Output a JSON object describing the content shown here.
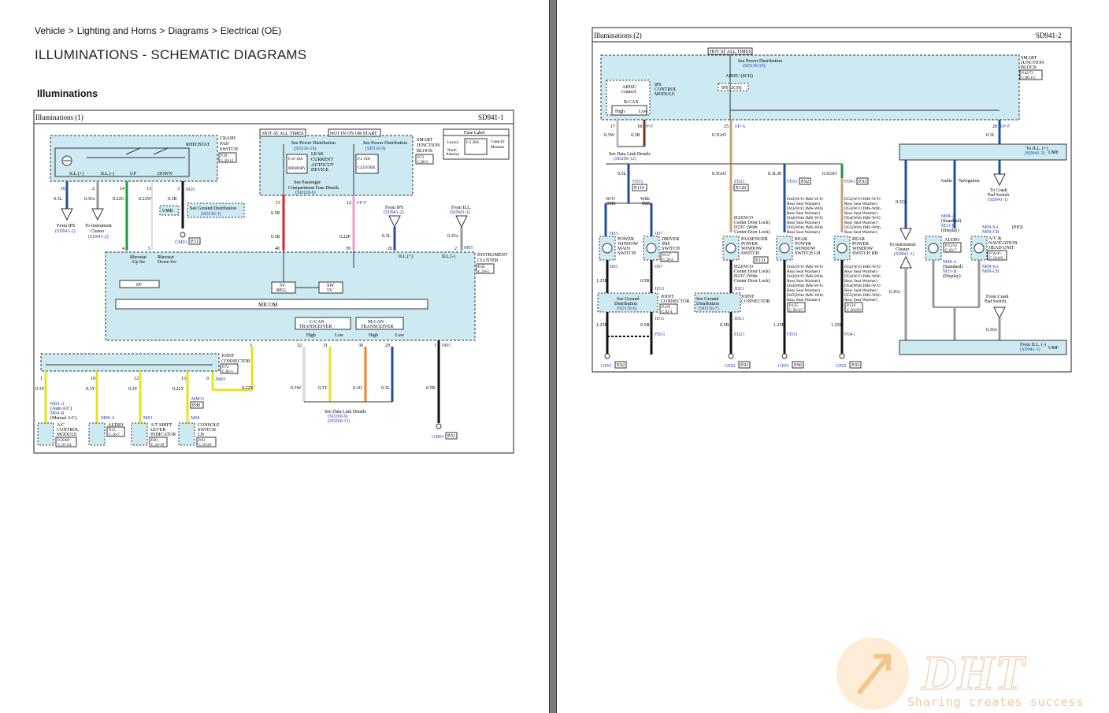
{
  "breadcrumb": [
    "Vehicle",
    "Lighting and Horns",
    "Diagrams",
    "Electrical (OE)"
  ],
  "page_title": "ILLUMINATIONS - SCHEMATIC DIAGRAMS",
  "section_title": "Illuminations",
  "diagram1": {
    "title": "Illuminations (1)",
    "code": "SD941-1",
    "crash_pad_switch": [
      "CRASH",
      "PAD",
      "SWITCH"
    ],
    "crash_pad_ref": [
      "P.39",
      "C.10-12"
    ],
    "rheostat": "RHEOSTAT",
    "ill_plus": "ILL.(+)",
    "ill_minus": "ILL.(-)",
    "up": "UP",
    "down": "DOWN",
    "hot_at_all_times": "HOT AT ALL TIMES",
    "hot_in_on_or_start": "HOT IN ON OR START",
    "see_power_distribution": "See Power Distribution",
    "sd110_10": "(SD110-10)",
    "sd110_9": "(SD110-9)",
    "leak_current": [
      "LEAK",
      "CURRENT",
      "AUTOCUT",
      "DEVICE"
    ],
    "f_memory": "F.10 10A",
    "memory": "MEMORY",
    "f_cluster": "F.2 10A",
    "cluster": "CLUSTER",
    "smart_junction_block": [
      "SMART",
      "JUNCTION",
      "BLOCK"
    ],
    "sjb_ref": [
      "P.72",
      "C.80-5"
    ],
    "see_passenger_fuse": [
      "See Passenger",
      "Compartment Fuse Details",
      "(SD120-9)"
    ],
    "fuse_label": "Fuse Label",
    "fuse_label_rows": [
      "Layout",
      "F.2 20A",
      "Capacity",
      "North",
      "America",
      "Measure"
    ],
    "pins_top": [
      "16",
      "2",
      "14",
      "13",
      "3"
    ],
    "wires_top": [
      "0.3L",
      "0.3Gr",
      "0.22G",
      "0.22W",
      "0.3B"
    ],
    "m26": "M26",
    "umb": "UMB",
    "see_ground_dist": [
      "See Ground Distribution",
      "(SD130-1)"
    ],
    "from_ips": [
      "From IPS",
      "(SD941-2)"
    ],
    "to_instrument_cluster": [
      "To Instrument",
      "Cluster",
      "(SD941-2)"
    ],
    "gm01": "GM01",
    "p51": "P.51",
    "sjb_pin_15": "15",
    "sjb_pin_12": "12",
    "i_p_f": "I/P-F",
    "wire_05r": "0.5R",
    "wire_022p": "0.22P",
    "from_ill": [
      "From ILL.",
      "(SD941-2)"
    ],
    "wire_03l": "0.3L",
    "wire_03gr": "0.3Gr",
    "pins_mid": [
      "4",
      "3",
      "40",
      "39",
      "20",
      "2"
    ],
    "m05": "M05",
    "instrument_cluster": [
      "INSTRUMENT",
      "CLUSTER"
    ],
    "ic_ref": [
      "P.43",
      "C.10-5"
    ],
    "rheostat_up_sw": [
      "Rheostat",
      "Up Sw"
    ],
    "rheostat_down_sw": [
      "Rheostat",
      "Down Sw"
    ],
    "if": "I/F",
    "ill_plus_ic": "ILL.(+)",
    "ill_minus_ic": "ILL.(-)",
    "reg_5v": [
      "5V",
      "REG."
    ],
    "sw_5v": [
      "SW",
      "5V"
    ],
    "micom": "MICOM",
    "c_can": [
      "C-CAN",
      "TRANSCEIVER"
    ],
    "m_can": [
      "M-CAN",
      "TRANSCEIVER"
    ],
    "high": "High",
    "low": "Low",
    "pins_bottom": [
      "5",
      "32",
      "31",
      "30",
      "29",
      "1"
    ],
    "wires_bottom": [
      "0.3W",
      "0.3Y",
      "0.3O",
      "0.3L",
      "0.5B"
    ],
    "see_data_link": [
      "See Data Link Details",
      "(SD200-9)",
      "(SD200-11)"
    ],
    "joint_connector": [
      "JOINT",
      "CONNECTOR"
    ],
    "jc_ref": [
      "P.72",
      "C.82-5"
    ],
    "jm05": "JM05",
    "jc_pins": [
      "1",
      "10",
      "12",
      "13",
      "9"
    ],
    "jc_wires": [
      "0.3Y",
      "0.3Y",
      "0.3Y",
      "0.22Y",
      "0.22Y"
    ],
    "m03a": "M03-A",
    "auto_ac": "(Auto A/C)",
    "m04b": "M04-B",
    "manual_ac": "(Manual A/C)",
    "ac_control": [
      "A/C",
      "CONTROL",
      "MODULE"
    ],
    "ac_ref": [
      "P.59/60",
      "C.10-3/4"
    ],
    "audio": "AUDIO",
    "m08a": "M08-A",
    "audio_ref": [
      "P.53",
      "C.10-7"
    ],
    "m63": "M63",
    "at_shift": [
      "A/T SHIFT",
      "LEVER",
      "INDICATOR"
    ],
    "at_ref": [
      "P.81",
      "C.10-19"
    ],
    "mm11": "MM11",
    "p80": "P.80",
    "m68": "M68",
    "console_switch": [
      "CONSOLE",
      "SWITCH",
      "LH"
    ],
    "console_ref": [
      "P.81",
      "C.10-20"
    ],
    "gm01b": "GM01",
    "p51b": "P.51"
  },
  "diagram2": {
    "title": "Illuminations (2)",
    "code": "SD941-2",
    "hot_at_all_times": "HOT AT ALL TIMES",
    "see_power_distribution": [
      "See Power Distribution",
      "(SD110-10)"
    ],
    "arisu_4ch": "ARISU (4CH)",
    "arisu_control": [
      "ARISU",
      "Control"
    ],
    "b_can": "B-CAN",
    "ips_control_module": [
      "IPS",
      "CONTROL",
      "MODULE"
    ],
    "ips_2ch": "IPS (2CH)",
    "smart_junction_block": [
      "SMART",
      "JUNCTION",
      "BLOCK"
    ],
    "sjb_ref": [
      "P.42/72",
      "C.80-1/5"
    ],
    "pins_top": [
      "17",
      "18",
      "25",
      "20"
    ],
    "ip_f": "I/P-F",
    "ip_a": "I/P-A",
    "ip_f2": "I/P-F",
    "wires_top": [
      "0.3W",
      "0.3B",
      "0.3GrO",
      "0.3L"
    ],
    "see_data_link": [
      "See Data Link Details",
      "(SD200-12)"
    ],
    "ume": "UME",
    "to_ill": [
      "To ILL. (+)",
      "(SD941-3)"
    ],
    "audio": "Audio",
    "navigation": "Navigation",
    "to_crash_pad": [
      "To Crash",
      "Pad Switch",
      "(SD941-1)"
    ],
    "branch_wires": [
      "0.3L",
      "0.3GrO",
      "0.3L/B",
      "0.3GrO"
    ],
    "fd11": "FD11",
    "fd21": "FD21",
    "fd31": "FD31",
    "fd41": "FD41",
    "p116": "P.116",
    "p120": "P.120",
    "p92": "P.92",
    "p93": "P.93",
    "wo_ims": [
      "W/O",
      "IMS"
    ],
    "with_ims": [
      "With",
      "IMS"
    ],
    "d03": "D03",
    "d07": "D07",
    "power_window_main": [
      "POWER",
      "WINDOW",
      "MAIN",
      "SWITCH"
    ],
    "driver_ims": [
      "DRIVER",
      "IMS",
      "SWITCH"
    ],
    "p117": [
      "P.117",
      "C.50-2"
    ],
    "passenger_pw": [
      "PASSENGER",
      "POWER",
      "WINDOW",
      "SWITCH"
    ],
    "p121": "P.121",
    "rear_pw_lh": [
      "REAR",
      "POWER",
      "WINDOW",
      "SWITCH LH"
    ],
    "p125": [
      "P.125",
      "C.50-4/7"
    ],
    "rear_pw_rh": [
      "REAR",
      "POWER",
      "WINDOW",
      "SWITCH RH"
    ],
    "p124": [
      "P.124",
      "C.50-8/9"
    ],
    "d23": [
      "D23(W/O",
      "Center Door Lock)",
      "D23C (With",
      "Center Door Lock)"
    ],
    "d42_list": [
      "D42(W/O IMS-W/O",
      "Rear Seat Warmer)",
      "D43(W/O IMS-With",
      "Rear Seat Warmer)",
      "D44(With IMS-W/O",
      "Rear Seat Warmer)",
      "D45(With IMS-With",
      "Rear Seat Warmer)"
    ],
    "d52_list": [
      "D52(W/O IMS-W/O",
      "Rear Seat Warmer)",
      "D53(W/O IMS-With",
      "Rear Seat Warmer)",
      "D54(With IMS-W/O",
      "Rear Seat Warmer)",
      "D55(With IMS-With",
      "Rear Seat Warmer)"
    ],
    "jd11": "JD11",
    "jd21": "JD21",
    "joint_connector": [
      "JOINT",
      "CONNECTOR"
    ],
    "p119": [
      "P.119",
      "C.82-1"
    ],
    "see_ground_dist": [
      "See Ground",
      "Distribution",
      "(SD130-6)"
    ],
    "see_ground_dist2": [
      "See Ground",
      "Distribution",
      "(SD130-7)"
    ],
    "ground_pins": [
      "10",
      "8",
      "3",
      "4",
      "3"
    ],
    "wire_125b": "1.25B",
    "wire_05b": "0.5B",
    "gf01": "GF01",
    "gf02": "GF02",
    "gf03": "GF03",
    "gf02b": "GF02",
    "p96": "P.96",
    "to_instrument_cluster": [
      "To Instrument",
      "Cluster",
      "(SD941-1)"
    ],
    "m08a": "M08-A",
    "standard": "(Standard)",
    "m33b": "M33-B",
    "display": "(Display)",
    "audio_unit": [
      "AUDIO",
      "P.53/54",
      "C.10-7"
    ],
    "m09sa": "M09-SA",
    "m09cb": "M09-CB",
    "pio": "(PIO)",
    "av_nav": [
      "A/V &",
      "NAVIGATION",
      "HEAD UNIT"
    ],
    "av_ref": [
      "P.56/45",
      "C.10-8/9"
    ],
    "from_crash_pad": [
      "From Crash",
      "Pad Switch"
    ],
    "umf": "UMF",
    "from_ill_minus": [
      "From ILL. (-)",
      "(SD941-3)"
    ],
    "wire_03gr": "0.3Gr"
  },
  "watermark": {
    "logo": "DHT",
    "slogan": "Sharing creates success",
    "color": "#f0b878"
  }
}
